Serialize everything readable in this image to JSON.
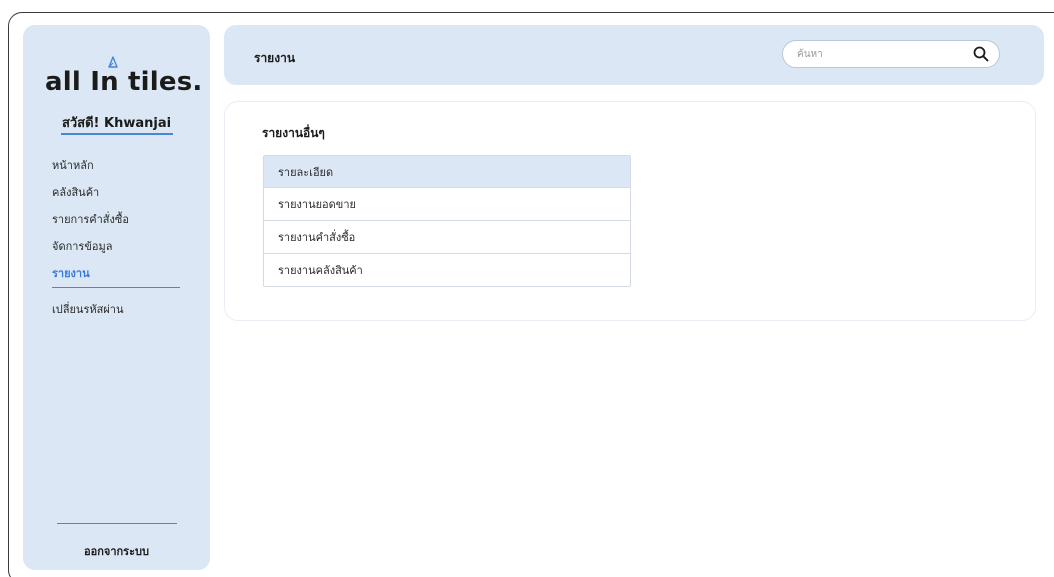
{
  "logo": {
    "text": "all In tiles."
  },
  "sidebar": {
    "greeting": "สวัสดี! Khwanjai",
    "items": [
      {
        "label": "หน้าหลัก",
        "active": false
      },
      {
        "label": "คลังสินค้า",
        "active": false
      },
      {
        "label": "รายการคำสั่งซื้อ",
        "active": false
      },
      {
        "label": "จัดการข้อมูล",
        "active": false
      },
      {
        "label": "รายงาน",
        "active": true
      },
      {
        "label": "เปลี่ยนรหัสผ่าน",
        "active": false
      }
    ],
    "logout_label": "ออกจากระบบ"
  },
  "header": {
    "title": "รายงาน",
    "search_placeholder": "ค้นหา"
  },
  "main": {
    "section_title": "รายงานอื่นๆ",
    "reports": [
      {
        "label": "รายละเอียด",
        "active": true
      },
      {
        "label": "รายงานยอดขาย",
        "active": false
      },
      {
        "label": "รายงานคำสั่งซื้อ",
        "active": false
      },
      {
        "label": "รายงานคลังสินค้า",
        "active": false
      }
    ]
  },
  "colors": {
    "panel_bg": "#dbe7f4",
    "accent": "#3a7bd5",
    "logo_mark": "#4a86d6"
  },
  "icons": {
    "search": "search-icon",
    "logo_mark": "triangle-icon"
  }
}
